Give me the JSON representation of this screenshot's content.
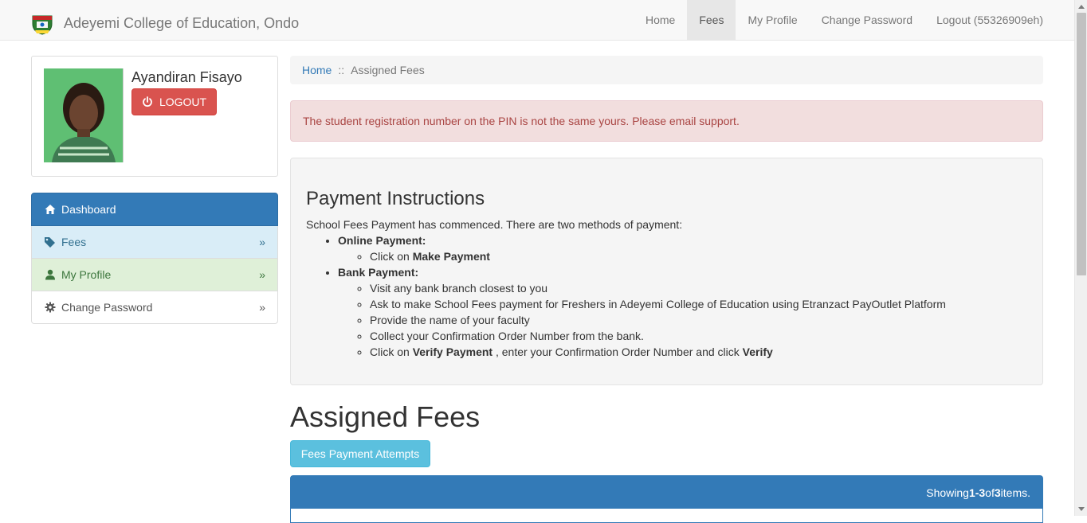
{
  "brand": {
    "title": "Adeyemi College of Education, Ondo"
  },
  "nav": {
    "items": [
      {
        "label": "Home"
      },
      {
        "label": "Fees"
      },
      {
        "label": "My Profile"
      },
      {
        "label": "Change Password"
      },
      {
        "label": "Logout (55326909eh)"
      }
    ],
    "active": "Fees"
  },
  "profile": {
    "name": "Ayandiran Fisayo",
    "logout_label": "LOGOUT"
  },
  "sidebar": {
    "header": "Dashboard",
    "items": [
      {
        "label": "Fees",
        "icon": "tags-icon",
        "chevron": "»"
      },
      {
        "label": "My Profile",
        "icon": "user-icon",
        "chevron": "»"
      },
      {
        "label": "Change Password",
        "icon": "gear-icon",
        "chevron": "»"
      }
    ]
  },
  "breadcrumb": {
    "home": "Home",
    "separator": "::",
    "current": "Assigned Fees"
  },
  "alert": {
    "message": "The student registration number on the PIN is not the same yours. Please email support."
  },
  "instructions": {
    "title": "Payment Instructions",
    "intro": "School Fees Payment has commenced. There are two methods of payment:",
    "online": {
      "heading": "Online Payment:",
      "step_prefix": "Click on ",
      "step_bold": "Make Payment"
    },
    "bank": {
      "heading": "Bank Payment:",
      "steps": [
        "Visit any bank branch closest to you",
        "Ask to make School Fees payment for Freshers in Adeyemi College of Education using Etranzact PayOutlet Platform",
        "Provide the name of your faculty",
        "Collect your Confirmation Order Number from the bank."
      ],
      "verify_prefix": "Click on ",
      "verify_bold": "Verify Payment",
      "verify_middle": " , enter your Confirmation Order Number and click ",
      "verify_end": "Verify"
    }
  },
  "fees": {
    "title": "Assigned Fees",
    "attempts_button": "Fees Payment Attempts",
    "summary_prefix": "Showing ",
    "summary_range": "1-3",
    "summary_of": " of ",
    "summary_total": "3",
    "summary_suffix": " items."
  },
  "colors": {
    "primary": "#337ab7",
    "danger": "#d9534f",
    "info": "#5bc0de",
    "alert_bg": "#f2dede"
  }
}
